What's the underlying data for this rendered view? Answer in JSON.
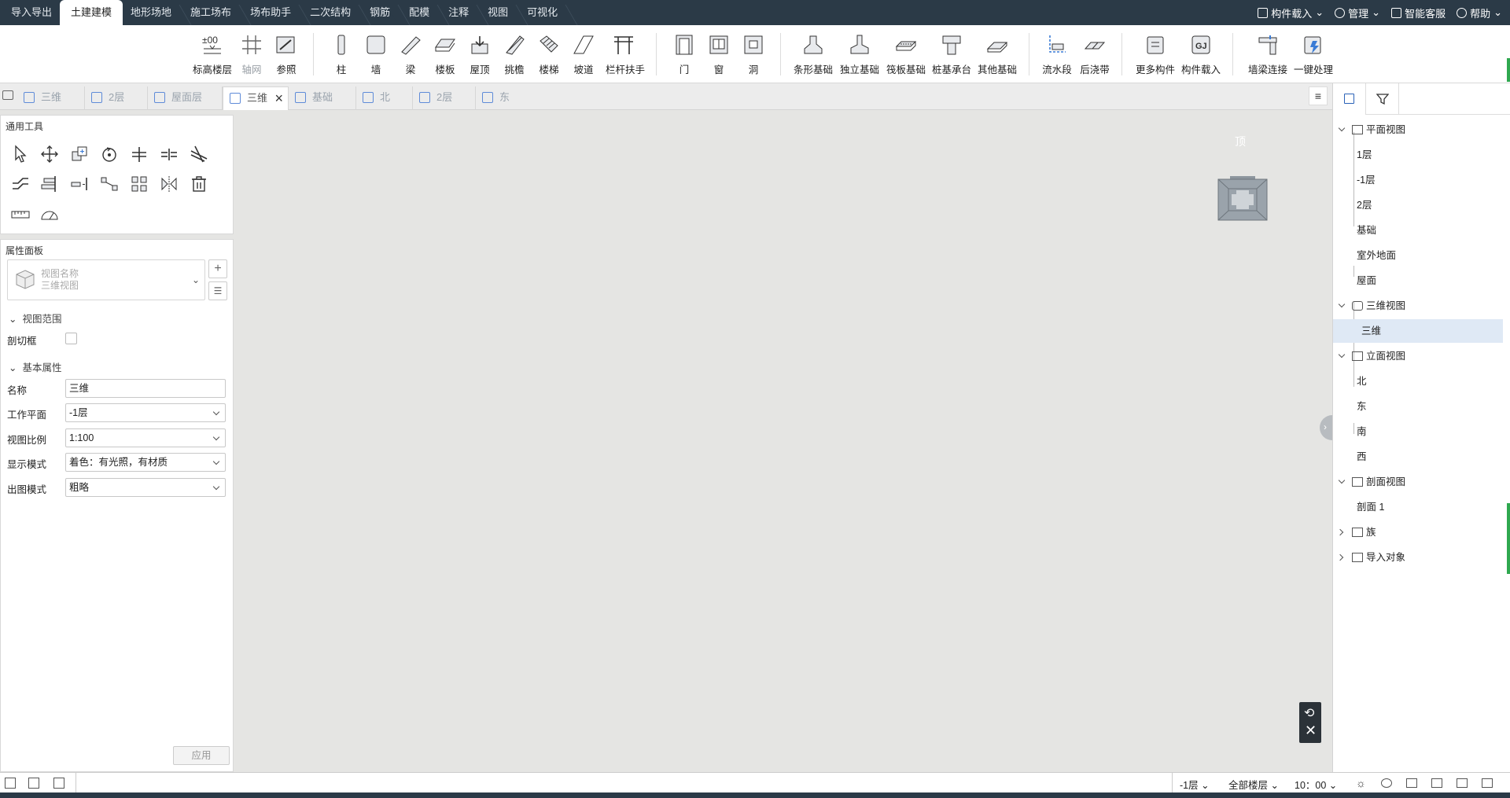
{
  "top_tabs": [
    "导入导出",
    "土建建模",
    "地形场地",
    "施工场布",
    "场布助手",
    "二次结构",
    "钢筋",
    "配模",
    "注释",
    "视图",
    "可视化"
  ],
  "active_tab": "土建建模",
  "top_right": {
    "load": "构件载入",
    "manage": "管理",
    "service": "智能客服",
    "help": "帮助"
  },
  "ribbon": {
    "level": "标高楼层",
    "axis": "轴网",
    "ref": "参照",
    "column": "柱",
    "wall": "墙",
    "beam": "梁",
    "slab": "楼板",
    "roof": "屋顶",
    "eave": "挑檐",
    "stair": "楼梯",
    "ramp": "坡道",
    "rail": "栏杆扶手",
    "door": "门",
    "window": "窗",
    "hole": "洞",
    "strip_found": "条形基础",
    "iso_found": "独立基础",
    "raft_found": "筏板基础",
    "pile_cap": "桩基承台",
    "other_found": "其他基础",
    "flow": "流水段",
    "post_pour": "后浇带",
    "more": "更多构件",
    "comp_load": "构件载入",
    "wall_beam": "墙梁连接",
    "one_key": "一键处理",
    "level_icon_text": "±00"
  },
  "view_tabs": [
    "三维",
    "2层",
    "屋面层",
    "三维",
    "基础",
    "北",
    "2层",
    "东"
  ],
  "active_view_index": 3,
  "menu_icon": "≡",
  "general_tools": {
    "title": "通用工具"
  },
  "properties": {
    "title": "属性面板",
    "view_name_label": "视图名称",
    "view_name_value": "三维视图",
    "section_range": "视图范围",
    "section_box_label": "剖切框",
    "section_basic": "基本属性",
    "fields": [
      {
        "label": "名称",
        "value": "三维"
      },
      {
        "label": "工作平面",
        "value": "-1层"
      },
      {
        "label": "视图比例",
        "value": "1:100"
      },
      {
        "label": "显示模式",
        "value": "着色：有光照，有材质"
      },
      {
        "label": "出图模式",
        "value": "粗略"
      }
    ],
    "apply": "应用"
  },
  "viewport": {
    "cube_label": "顶"
  },
  "tree": {
    "plan": "平面视图",
    "plan_items": [
      "1层",
      "-1层",
      "2层",
      "基础",
      "室外地面",
      "屋面"
    ],
    "three_d": "三维视图",
    "three_d_items": [
      "三维"
    ],
    "elevation": "立面视图",
    "elevation_items": [
      "北",
      "东",
      "南",
      "西"
    ],
    "section": "剖面视图",
    "section_items": [
      "剖面 1"
    ],
    "family": "族",
    "imported": "导入对象"
  },
  "status": {
    "level": "-1层",
    "all_levels": "全部楼层",
    "time": "10：00"
  },
  "colors": {
    "topbar": "#2b3a47",
    "accent": "#3a7bd5",
    "selection": "#dfe9f5",
    "canvas": "#e5e5e3"
  }
}
